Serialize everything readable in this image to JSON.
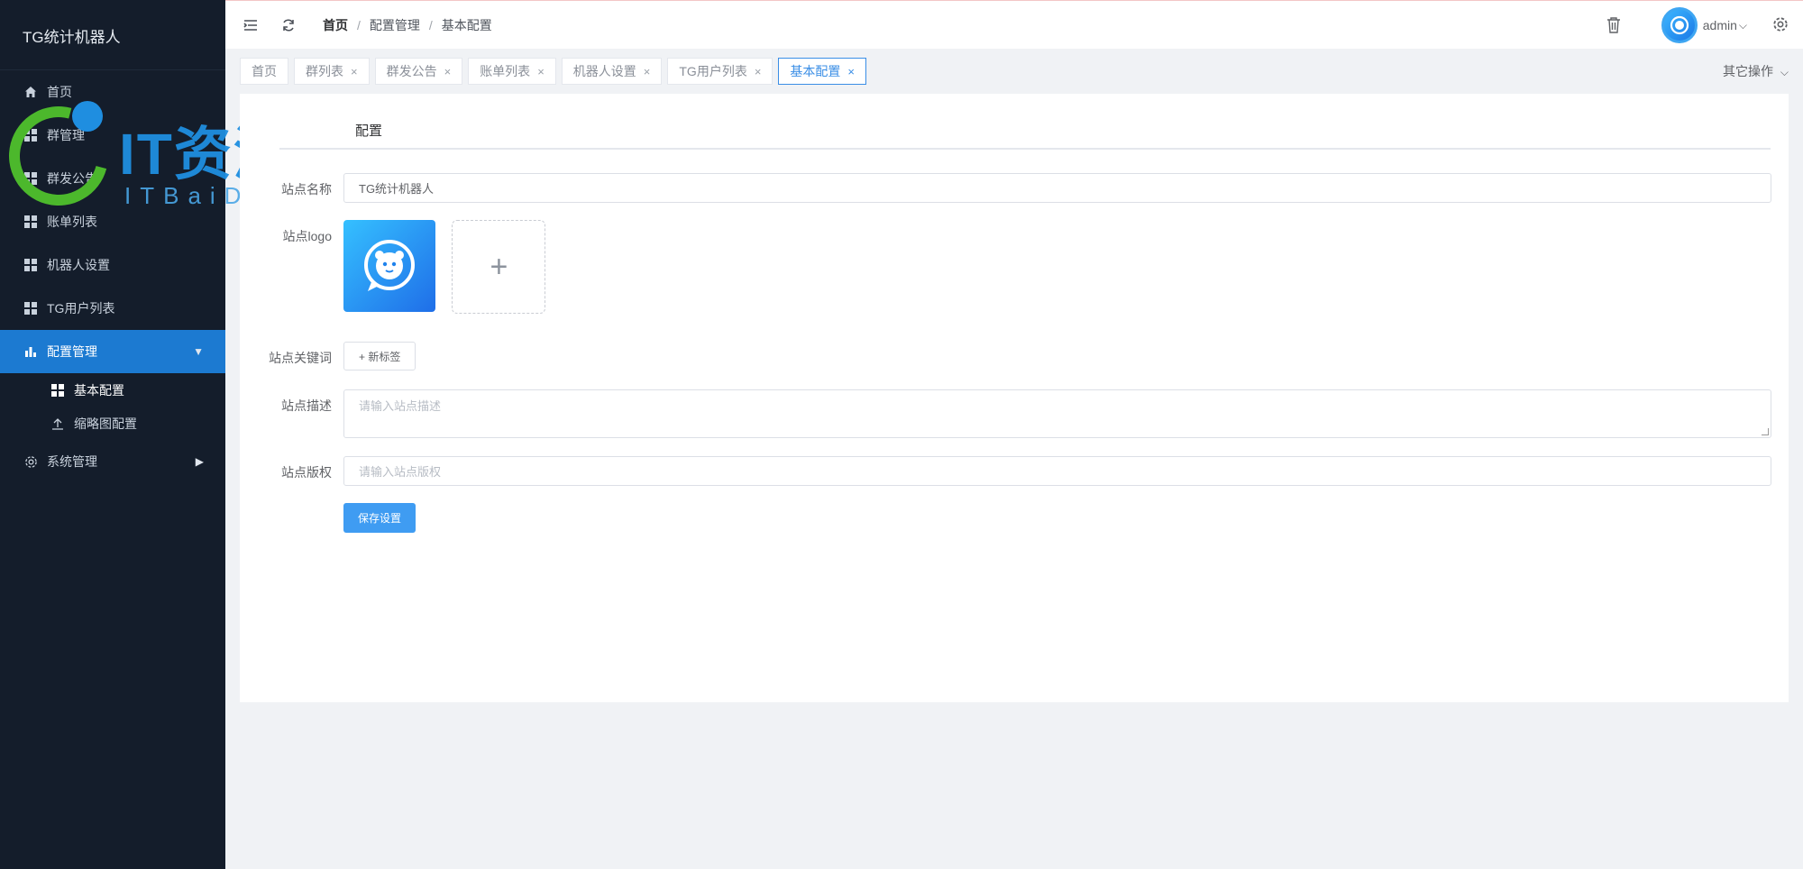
{
  "sidebar": {
    "brand": "TG统计机器人",
    "items": [
      {
        "label": "首页"
      },
      {
        "label": "群管理"
      },
      {
        "label": "群发公告"
      },
      {
        "label": "账单列表"
      },
      {
        "label": "机器人设置"
      },
      {
        "label": "TG用户列表"
      },
      {
        "label": "配置管理"
      },
      {
        "label": "系统管理"
      }
    ],
    "sub_items": [
      {
        "label": "基本配置"
      },
      {
        "label": "缩略图配置"
      }
    ]
  },
  "watermark": {
    "title": "IT资源网",
    "subtitle": "ITBaiDu.com"
  },
  "header": {
    "breadcrumb": [
      "首页",
      "配置管理",
      "基本配置"
    ],
    "separator": "/",
    "username": "admin"
  },
  "tabs": {
    "items": [
      {
        "label": "首页"
      },
      {
        "label": "群列表",
        "close": "×"
      },
      {
        "label": "群发公告",
        "close": "×"
      },
      {
        "label": "账单列表",
        "close": "×"
      },
      {
        "label": "机器人设置",
        "close": "×"
      },
      {
        "label": "TG用户列表",
        "close": "×"
      },
      {
        "label": "基本配置",
        "close": "×"
      }
    ],
    "more_ops": "其它操作"
  },
  "form": {
    "tab_label": "配置",
    "site_name_label": "站点名称",
    "site_name_value": "TG统计机器人",
    "site_logo_label": "站点logo",
    "upload_plus": "+",
    "keywords_label": "站点关键词",
    "new_tag": "+ 新标签",
    "desc_label": "站点描述",
    "desc_placeholder": "请输入站点描述",
    "copyright_label": "站点版权",
    "copyright_placeholder": "请输入站点版权",
    "save": "保存设置"
  },
  "colors": {
    "sidebar_bg": "#141d2b",
    "active_menu": "#1c7ad1",
    "accent": "#3a8ee6"
  }
}
